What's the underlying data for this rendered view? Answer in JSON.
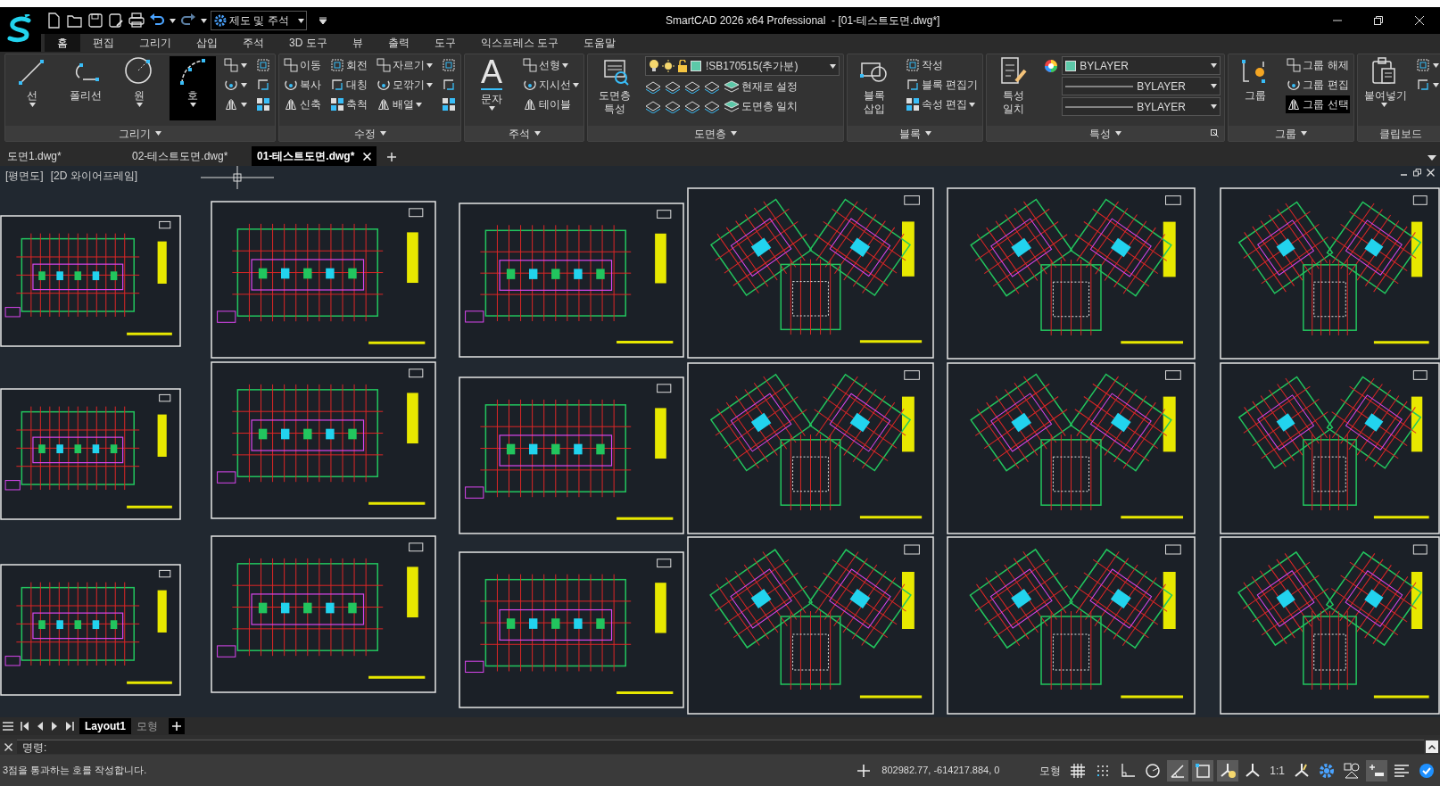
{
  "title_bar": {
    "workspace": "제도 및 주석",
    "title": "SmartCAD 2026 x64 Professional  - [01-테스트도면.dwg*]"
  },
  "ribbon_tabs": [
    {
      "label": "홈",
      "selected": true
    },
    {
      "label": "편집",
      "selected": false
    },
    {
      "label": "그리기",
      "selected": false
    },
    {
      "label": "삽입",
      "selected": false
    },
    {
      "label": "주석",
      "selected": false
    },
    {
      "label": "3D 도구",
      "selected": false
    },
    {
      "label": "뷰",
      "selected": false
    },
    {
      "label": "출력",
      "selected": false
    },
    {
      "label": "도구",
      "selected": false
    },
    {
      "label": "익스프레스 도구",
      "selected": false
    },
    {
      "label": "도움말",
      "selected": false
    }
  ],
  "ribbon_panels": [
    {
      "title": "그리기",
      "caret": true,
      "launcher": false,
      "columns": [
        [
          {
            "kind": "large",
            "label": "선",
            "caret": true,
            "selected": false
          }
        ],
        [
          {
            "kind": "large",
            "label": "폴리선",
            "caret": false,
            "selected": false
          }
        ],
        [
          {
            "kind": "large",
            "label": "원",
            "caret": true,
            "selected": false
          }
        ],
        [
          {
            "kind": "large",
            "label": "호",
            "caret": true,
            "selected": true
          }
        ],
        [
          {
            "kind": "icon",
            "caret": true,
            "selected": false
          },
          {
            "kind": "icon",
            "caret": true,
            "selected": false
          },
          {
            "kind": "icon",
            "caret": true,
            "selected": false
          }
        ],
        [
          {
            "kind": "icon",
            "caret": false,
            "selected": false
          },
          {
            "kind": "icon",
            "caret": false,
            "selected": false
          },
          {
            "kind": "icon",
            "caret": false,
            "selected": false
          }
        ]
      ]
    },
    {
      "title": "수정",
      "caret": true,
      "launcher": false,
      "columns": [
        [
          {
            "kind": "small",
            "label": "이동",
            "caret": false,
            "selected": false
          },
          {
            "kind": "small",
            "label": "복사",
            "caret": false,
            "selected": false
          },
          {
            "kind": "small",
            "label": "신축",
            "caret": false,
            "selected": false
          }
        ],
        [
          {
            "kind": "small",
            "label": "회전",
            "caret": false,
            "selected": false
          },
          {
            "kind": "small",
            "label": "대칭",
            "caret": false,
            "selected": false
          },
          {
            "kind": "small",
            "label": "축척",
            "caret": false,
            "selected": false
          }
        ],
        [
          {
            "kind": "small",
            "label": "자르기",
            "caret": true,
            "selected": false
          },
          {
            "kind": "small",
            "label": "모깎기",
            "caret": true,
            "selected": false
          },
          {
            "kind": "small",
            "label": "배열",
            "caret": true,
            "selected": false
          }
        ],
        [
          {
            "kind": "icon",
            "caret": false,
            "selected": false
          },
          {
            "kind": "icon",
            "caret": false,
            "selected": false
          },
          {
            "kind": "icon",
            "caret": false,
            "selected": false
          }
        ]
      ]
    },
    {
      "title": "주석",
      "caret": true,
      "launcher": false,
      "columns": [
        [
          {
            "kind": "large",
            "label": "문자",
            "icon_text": "A",
            "caret": true,
            "selected": false
          }
        ],
        [
          {
            "kind": "small",
            "label": "선형",
            "caret": true,
            "selected": false
          },
          {
            "kind": "small",
            "label": "지시선",
            "caret": true,
            "selected": false
          },
          {
            "kind": "small",
            "label": "테이블",
            "caret": false,
            "selected": false
          }
        ]
      ]
    },
    {
      "title": "도면층",
      "caret": true,
      "launcher": false,
      "columns": [
        [
          {
            "kind": "large",
            "label": "도면층 특성",
            "caret": false,
            "selected": false
          }
        ],
        [
          {
            "kind": "layer_combo",
            "label": "!SB170515(추가분)"
          },
          {
            "kind": "tool_row",
            "label": "현재로 설정"
          },
          {
            "kind": "tool_row",
            "label": "도면층 일치"
          }
        ]
      ]
    },
    {
      "title": "블록",
      "caret": true,
      "launcher": false,
      "columns": [
        [
          {
            "kind": "large",
            "label": "블록 삽입",
            "caret": false,
            "selected": false
          }
        ],
        [
          {
            "kind": "small",
            "label": "작성",
            "caret": false,
            "selected": false
          },
          {
            "kind": "small",
            "label": "블록 편집기",
            "caret": false,
            "selected": false
          },
          {
            "kind": "small",
            "label": "속성 편집",
            "caret": true,
            "selected": false
          }
        ]
      ]
    },
    {
      "title": "특성",
      "caret": true,
      "launcher": true,
      "columns": [
        [
          {
            "kind": "large",
            "label": "특성 일치",
            "caret": false,
            "selected": false
          }
        ],
        [
          {
            "kind": "color_combo",
            "label": "BYLAYER"
          },
          {
            "kind": "line_combo",
            "label": "BYLAYER"
          },
          {
            "kind": "line_combo",
            "label": "BYLAYER"
          }
        ]
      ]
    },
    {
      "title": "그룹",
      "caret": true,
      "launcher": false,
      "columns": [
        [
          {
            "kind": "large",
            "label": "그룹",
            "caret": false,
            "selected": false
          }
        ],
        [
          {
            "kind": "small",
            "label": "그룹 해제",
            "caret": false,
            "selected": false
          },
          {
            "kind": "small",
            "label": "그룹 편집",
            "caret": false,
            "selected": false
          },
          {
            "kind": "small",
            "label": "그룹 선택",
            "caret": false,
            "selected": true
          }
        ]
      ]
    },
    {
      "title": "클립보드",
      "caret": false,
      "launcher": false,
      "columns": [
        [
          {
            "kind": "large",
            "label": "붙여넣기",
            "caret": true,
            "selected": false
          }
        ],
        [
          {
            "kind": "icon",
            "caret": true,
            "selected": false
          },
          {
            "kind": "icon",
            "caret": true,
            "selected": false
          }
        ]
      ]
    }
  ],
  "file_tabs": [
    {
      "label": "도면1.dwg*",
      "selected": false
    },
    {
      "label": "02-테스트도면.dwg*",
      "selected": false
    },
    {
      "label": "01-테스트도면.dwg*",
      "selected": true
    }
  ],
  "viewport": {
    "view": "[평면도]",
    "style": "[2D 와이어프레임]"
  },
  "layout_tabs": [
    {
      "label": "Layout1",
      "selected": true
    },
    {
      "label": "모형",
      "selected": false
    }
  ],
  "command": {
    "prompt": "명령:",
    "history": "3점을 통과하는 호를 작성합니다."
  },
  "status_bar": {
    "coordinates": "802982.77, -614217.884, 0",
    "items": [
      {
        "kind": "text",
        "label": "모형",
        "on": false
      },
      {
        "kind": "toggle",
        "on": false
      },
      {
        "kind": "toggle",
        "on": false
      },
      {
        "kind": "toggle",
        "on": false
      },
      {
        "kind": "toggle",
        "on": false
      },
      {
        "kind": "toggle",
        "on": true
      },
      {
        "kind": "toggle",
        "on": true
      },
      {
        "kind": "toggle",
        "on": true
      },
      {
        "kind": "toggle",
        "on": false
      },
      {
        "kind": "text",
        "label": "1:1",
        "on": false
      },
      {
        "kind": "toggle",
        "on": false
      },
      {
        "kind": "toggle",
        "on": false
      },
      {
        "kind": "toggle",
        "on": false
      },
      {
        "kind": "toggle",
        "on": true
      },
      {
        "kind": "toggle",
        "on": false
      },
      {
        "kind": "badge"
      }
    ]
  }
}
